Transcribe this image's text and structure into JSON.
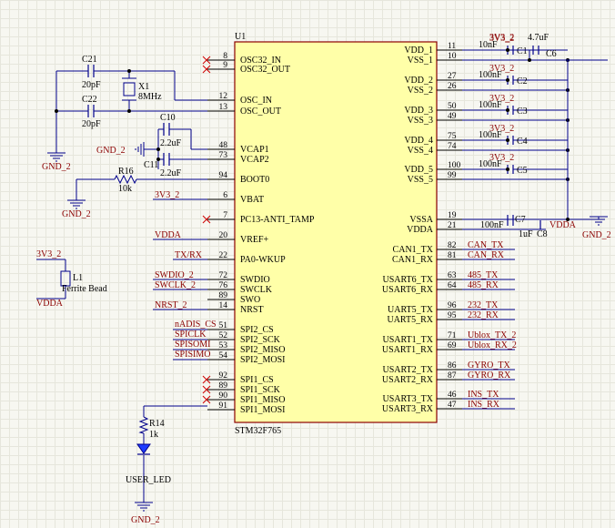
{
  "chip": {
    "designator": "U1",
    "part": "STM32F765",
    "left_pins": [
      {
        "num": "8",
        "name": "OSC32_IN",
        "nc": true
      },
      {
        "num": "9",
        "name": "OSC32_OUT",
        "nc": true
      },
      {
        "num": "12",
        "name": "OSC_IN"
      },
      {
        "num": "13",
        "name": "OSC_OUT"
      },
      {
        "num": "48",
        "name": "VCAP1"
      },
      {
        "num": "73",
        "name": "VCAP2"
      },
      {
        "num": "94",
        "name": "BOOT0"
      },
      {
        "num": "6",
        "name": "VBAT"
      },
      {
        "num": "7",
        "name": "PC13-ANTI_TAMP",
        "nc": true
      },
      {
        "num": "20",
        "name": "VREF+"
      },
      {
        "num": "22",
        "name": "PA0-WKUP"
      },
      {
        "num": "72",
        "name": "SWDIO"
      },
      {
        "num": "76",
        "name": "SWCLK"
      },
      {
        "num": "89",
        "name": "SWO"
      },
      {
        "num": "14",
        "name": "NRST"
      },
      {
        "num": "51",
        "name": "SPI2_CS"
      },
      {
        "num": "52",
        "name": "SPI2_SCK"
      },
      {
        "num": "53",
        "name": "SPI2_MISO"
      },
      {
        "num": "54",
        "name": "SPI2_MOSI"
      },
      {
        "num": "92",
        "name": "SPI1_CS",
        "nc": true
      },
      {
        "num": "89",
        "name": "SPI1_SCK",
        "nc": true
      },
      {
        "num": "90",
        "name": "SPI1_MISO",
        "nc": true
      },
      {
        "num": "91",
        "name": "SPI1_MOSI"
      }
    ],
    "right_pins": [
      {
        "num": "11",
        "name": "VDD_1"
      },
      {
        "num": "10",
        "name": "VSS_1"
      },
      {
        "num": "27",
        "name": "VDD_2"
      },
      {
        "num": "26",
        "name": "VSS_2"
      },
      {
        "num": "50",
        "name": "VDD_3"
      },
      {
        "num": "49",
        "name": "VSS_3"
      },
      {
        "num": "75",
        "name": "VDD_4"
      },
      {
        "num": "74",
        "name": "VSS_4"
      },
      {
        "num": "100",
        "name": "VDD_5"
      },
      {
        "num": "99",
        "name": "VSS_5"
      },
      {
        "num": "19",
        "name": "VSSA"
      },
      {
        "num": "21",
        "name": "VDDA"
      },
      {
        "num": "82",
        "name": "CAN1_TX"
      },
      {
        "num": "81",
        "name": "CAN1_RX"
      },
      {
        "num": "63",
        "name": "USART6_TX"
      },
      {
        "num": "64",
        "name": "USART6_RX"
      },
      {
        "num": "96",
        "name": "UART5_TX"
      },
      {
        "num": "95",
        "name": "UART5_RX"
      },
      {
        "num": "71",
        "name": "USART1_TX"
      },
      {
        "num": "69",
        "name": "USART1_RX"
      },
      {
        "num": "86",
        "name": "USART2_TX"
      },
      {
        "num": "87",
        "name": "USART2_RX"
      },
      {
        "num": "46",
        "name": "USART3_TX"
      },
      {
        "num": "47",
        "name": "USART3_RX"
      }
    ]
  },
  "left_nets": {
    "vbat": "3V3_2",
    "vref": "VDDA",
    "wkup": "TX/RX",
    "swdio": "SWDIO_2",
    "swclk": "SWCLK_2",
    "nrst": "NRST_2",
    "spi2_cs": "nADIS_CS",
    "spi2_sck": "SPICLK",
    "spi2_miso": "SPISOMI",
    "spi2_mosi": "SPISIMO"
  },
  "right_nets": [
    {
      "label": "CAN_TX"
    },
    {
      "label": "CAN_RX"
    },
    {
      "label": "485_TX"
    },
    {
      "label": "485_RX"
    },
    {
      "label": "232_TX"
    },
    {
      "label": "232_RX"
    },
    {
      "label": "Ublox_TX_2"
    },
    {
      "label": "Ublox_RX_2"
    },
    {
      "label": "GYRO_TX"
    },
    {
      "label": "GYRO_RX"
    },
    {
      "label": "INS_TX"
    },
    {
      "label": "INS_RX"
    }
  ],
  "oscillator": {
    "c21": {
      "ref": "C21",
      "value": "20pF"
    },
    "c22": {
      "ref": "C22",
      "value": "20pF"
    },
    "x1": {
      "ref": "X1",
      "value": "8MHz"
    },
    "gnd": "GND_2"
  },
  "vcap": {
    "c10": {
      "ref": "C10",
      "value": "2.2uF"
    },
    "c11": {
      "ref": "C11",
      "value": "2.2uF"
    },
    "gnd": "GND_2"
  },
  "boot": {
    "r16": {
      "ref": "R16",
      "value": "10k"
    },
    "gnd": "GND_2"
  },
  "ferrite": {
    "ref": "L1",
    "value": "Ferrite Bead",
    "in": "3V3_2",
    "out": "VDDA"
  },
  "led": {
    "r14": {
      "ref": "R14",
      "value": "1k"
    },
    "label": "USER_LED",
    "gnd": "GND_2"
  },
  "decoupling": {
    "caps": [
      {
        "ref": "C1",
        "value": "10nF",
        "net": "3V3_2"
      },
      {
        "ref": "C2",
        "value": "100nF",
        "net": "3V3_2"
      },
      {
        "ref": "C3",
        "value": "100nF",
        "net": "3V3_2"
      },
      {
        "ref": "C4",
        "value": "100nF",
        "net": "3V3_2"
      },
      {
        "ref": "C5",
        "value": "100nF",
        "net": "3V3_2"
      }
    ],
    "c6": {
      "ref": "C6",
      "value": "4.7uF",
      "net": "3V3_2"
    },
    "c7": {
      "ref": "C7",
      "value": "100nF"
    },
    "c8": {
      "ref": "C8",
      "value": "1uF",
      "net": "VDDA"
    },
    "gnd": "GND_2"
  }
}
